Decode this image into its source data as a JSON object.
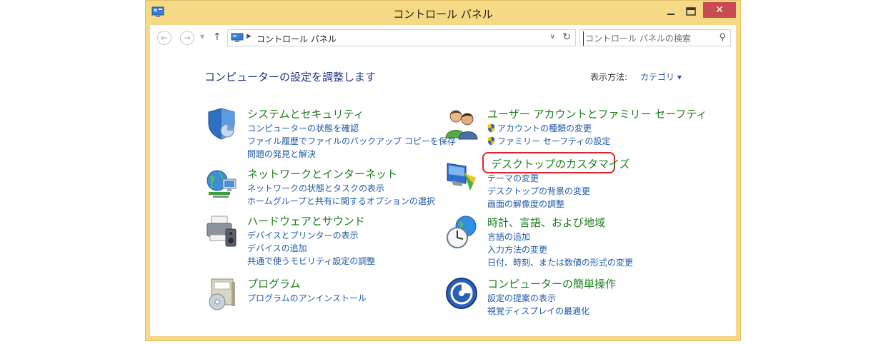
{
  "window": {
    "title": "コントロール パネル",
    "close_glyph": "✕"
  },
  "address": {
    "path": "コントロール パネル",
    "search_placeholder": "コントロール パネルの検索"
  },
  "content": {
    "heading": "コンピューターの設定を調整します",
    "view_by_label": "表示方法:",
    "view_by_value": "カテゴリ ▾"
  },
  "categories": {
    "system": {
      "title": "システムとセキュリティ",
      "links": [
        "コンピューターの状態を確認",
        "ファイル履歴でファイルのバックアップ コピーを保存",
        "問題の発見と解決"
      ]
    },
    "network": {
      "title": "ネットワークとインターネット",
      "links": [
        "ネットワークの状態とタスクの表示",
        "ホームグループと共有に関するオプションの選択"
      ]
    },
    "hardware": {
      "title": "ハードウェアとサウンド",
      "links": [
        "デバイスとプリンターの表示",
        "デバイスの追加",
        "共通で使うモビリティ設定の調整"
      ]
    },
    "programs": {
      "title": "プログラム",
      "links": [
        "プログラムのアンインストール"
      ]
    },
    "users": {
      "title": "ユーザー アカウントとファミリー セーフティ",
      "links": [
        "アカウントの種類の変更",
        "ファミリー セーフティの設定"
      ]
    },
    "appearance": {
      "title": "デスクトップのカスタマイズ",
      "links": [
        "テーマの変更",
        "デスクトップの背景の変更",
        "画面の解像度の調整"
      ]
    },
    "clock": {
      "title": "時計、言語、および地域",
      "links": [
        "言語の追加",
        "入力方法の変更",
        "日付、時刻、または数値の形式の変更"
      ]
    },
    "ease": {
      "title": "コンピューターの簡単操作",
      "links": [
        "設定の提案の表示",
        "視覚ディスプレイの最適化"
      ]
    }
  },
  "colors": {
    "title_bar": "#f6d985",
    "category_title": "#1d7f1d",
    "link": "#1e5aa8",
    "heading": "#1e3287",
    "close_button": "#c74b50",
    "highlight": "#e0232e"
  }
}
